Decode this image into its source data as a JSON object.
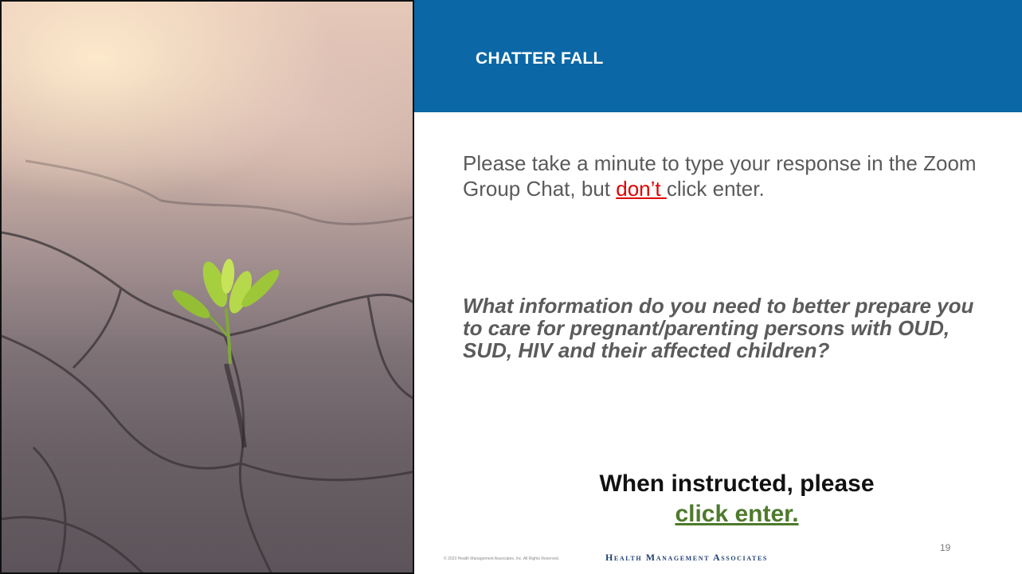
{
  "header": {
    "title": "CHATTER FALL"
  },
  "body": {
    "intro_before": "Please take a minute to type your response in the Zoom Group Chat, but ",
    "intro_emphasis": "don’t ",
    "intro_after": "click enter.",
    "question": "What information do you need to better prepare you to care for pregnant/parenting persons with OUD, SUD, HIV and their affected children?",
    "instruction_line1": "When instructed, please",
    "instruction_link": "click enter."
  },
  "footer": {
    "copyright": "© 2023 Health Management Associates, Inc. All Rights Reserved.",
    "brand": "Health Management Associates",
    "slide_number": "19"
  },
  "colors": {
    "header_bg": "#0b67a6",
    "emphasis_red": "#e00000",
    "link_green": "#4e7a2c"
  },
  "image": {
    "description_icon": "sprout-in-cracked-earth-photo"
  }
}
